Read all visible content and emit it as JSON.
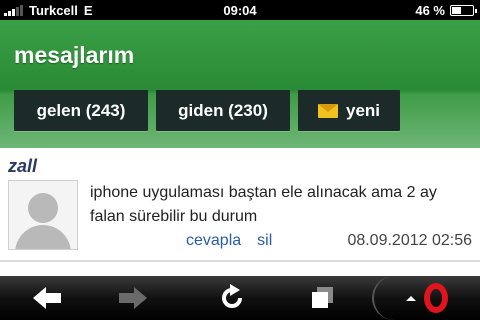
{
  "status_bar": {
    "carrier": "Turkcell",
    "network": "E",
    "time": "09:04",
    "battery_percent": "46 %",
    "battery_level": 0.46
  },
  "header": {
    "title": "mesajlarım"
  },
  "tabs": [
    {
      "label": "gelen (243)"
    },
    {
      "label": "giden (230)"
    },
    {
      "label": "yeni",
      "icon": "envelope-icon"
    }
  ],
  "message": {
    "sender": "zall",
    "text": "iphone uygulaması baştan ele alınacak ama 2 ay falan sürebilir bu durum",
    "reply_label": "cevapla",
    "delete_label": "sil",
    "date": "08.09.2012 02:56"
  },
  "toolbar": {
    "icons": [
      "back-arrow-icon",
      "forward-arrow-icon",
      "reload-icon",
      "tabs-icon",
      "opera-menu-icon"
    ]
  },
  "colors": {
    "header_green": "#2a8a35",
    "tab_bg": "#1c2a2a",
    "sender": "#2a3a66",
    "link": "#2a5ca8",
    "opera_red": "#e0141e"
  }
}
